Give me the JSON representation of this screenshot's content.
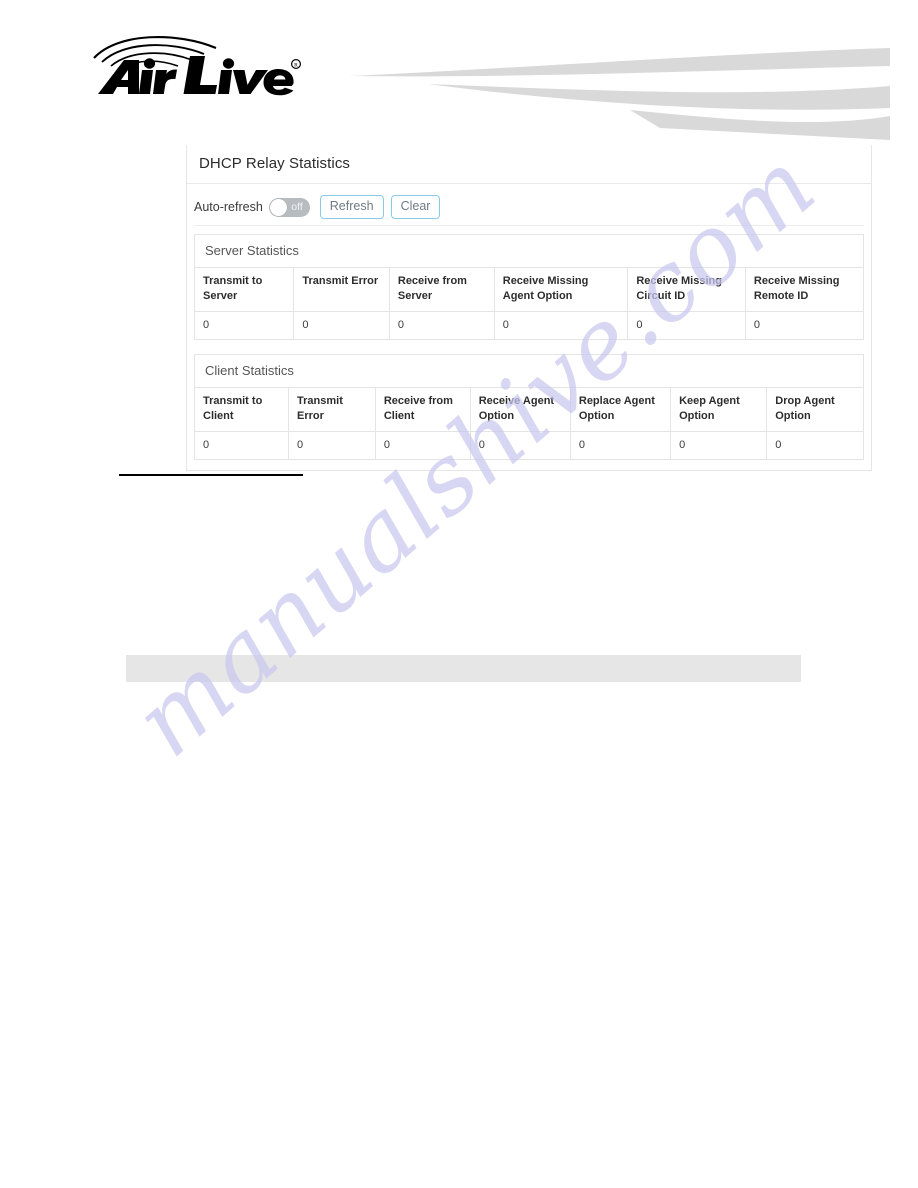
{
  "brand": {
    "logo_text": "Air Live",
    "logo_registered_mark": "®",
    "logo_icon": "wifi-arcs-icon",
    "banner_icon": "swoosh-graphic"
  },
  "panel": {
    "title": "DHCP Relay Statistics",
    "toolbar": {
      "auto_refresh_label": "Auto-refresh",
      "auto_refresh_state": "off",
      "auto_refresh_on": false,
      "refresh_label": "Refresh",
      "clear_label": "Clear"
    },
    "sections": [
      {
        "title": "Server Statistics",
        "columns": [
          "Transmit to Server",
          "Transmit Error",
          "Receive from Server",
          "Receive Missing Agent Option",
          "Receive Missing Circuit ID",
          "Receive Missing Remote ID"
        ],
        "column_widths": [
          "14.8%",
          "14.3%",
          "15.7%",
          "20.0%",
          "17.6%",
          "17.6%"
        ],
        "rows": [
          [
            "0",
            "0",
            "0",
            "0",
            "0",
            "0"
          ]
        ]
      },
      {
        "title": "Client Statistics",
        "columns": [
          "Transmit to Client",
          "Transmit Error",
          "Receive from Client",
          "Receive Agent Option",
          "Replace Agent Option",
          "Keep Agent Option",
          "Drop Agent Option"
        ],
        "column_widths": [
          "14.0%",
          "13.0%",
          "14.2%",
          "15.0%",
          "15.0%",
          "14.4%",
          "14.4%"
        ],
        "rows": [
          [
            "0",
            "0",
            "0",
            "0",
            "0",
            "0",
            "0"
          ]
        ]
      }
    ]
  },
  "watermark": {
    "text": "manualshive.com",
    "color": "#c8c8ef"
  },
  "colors": {
    "button_border": "#86cce6",
    "button_text": "#6f7b85",
    "toggle_off_track": "#b7bcc1",
    "panel_border": "#e4e4e4",
    "swoosh_gray": "#d9d9d9",
    "gray_bar": "#e6e6e6"
  }
}
